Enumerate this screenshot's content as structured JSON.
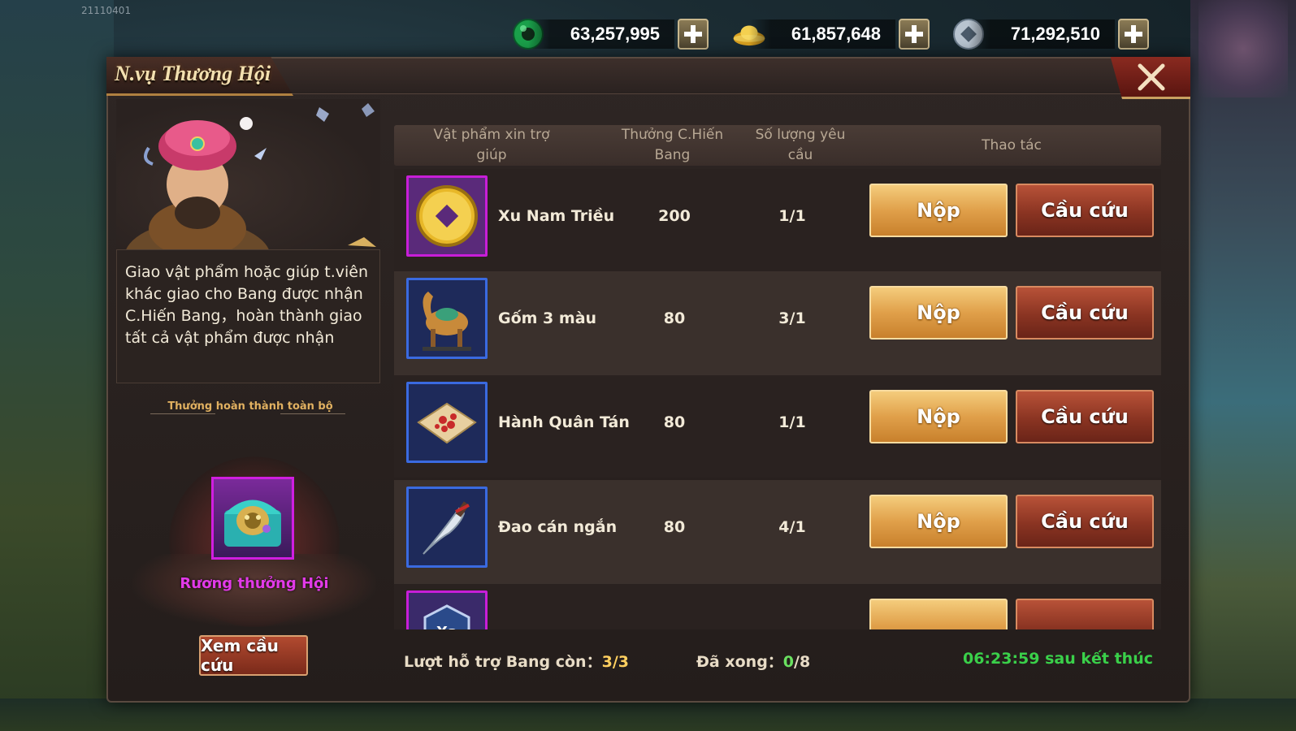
{
  "build_id": "21110401",
  "currencies": [
    {
      "name": "jade",
      "icon": "jade-ring-icon",
      "value": "63,257,995"
    },
    {
      "name": "gold",
      "icon": "gold-ingot-icon",
      "value": "61,857,648"
    },
    {
      "name": "silver",
      "icon": "silver-coin-icon",
      "value": "71,292,510"
    }
  ],
  "panel": {
    "title": "N.vụ Thương Hội",
    "npc_description": "Giao vật phẩm hoặc giúp t.viên khác giao cho Bang được nhận C.Hiến Bang，hoàn thành giao tất cả vật phẩm được nhận",
    "reward_label": "Thưởng hoàn thành toàn bộ",
    "reward_item_name": "Rương thưởng Hội",
    "view_help_button": "Xem cầu cứu"
  },
  "table": {
    "headers": {
      "item": "Vật phẩm xin trợ giúp",
      "reward": "Thưởng C.Hiến Bang",
      "quantity": "Số lượng yêu cầu",
      "action": "Thao tác"
    },
    "rows": [
      {
        "name": "Xu Nam Triều",
        "icon": "gold-coin-icon",
        "reward": "200",
        "quantity": "1/1",
        "border": "#c81ed8",
        "bg": "#5a2a7a"
      },
      {
        "name": "Gốm 3 màu",
        "icon": "ceramic-camel-icon",
        "reward": "80",
        "quantity": "3/1",
        "border": "#3a6ae0",
        "bg": "#1e2a5a"
      },
      {
        "name": "Hành Quân Tán",
        "icon": "medicine-packet-icon",
        "reward": "80",
        "quantity": "1/1",
        "border": "#3a6ae0",
        "bg": "#1e2a5a"
      },
      {
        "name": "Đao cán ngắn",
        "icon": "short-saber-icon",
        "reward": "80",
        "quantity": "4/1",
        "border": "#3a6ae0",
        "bg": "#1e2a5a"
      },
      {
        "name": "",
        "icon": "xa-badge-icon",
        "icon_text": "Xa",
        "reward": "",
        "quantity": "",
        "border": "#c81ed8",
        "bg": "#3a2a6a"
      }
    ],
    "submit_label": "Nộp",
    "help_label": "Cầu cứu"
  },
  "footer": {
    "support_label": "Lượt hỗ trợ Bang còn：",
    "support_value": "3/3",
    "done_label": "Đã xong：",
    "done_value": "0",
    "done_total": "/8",
    "timer": "06:23:59 sau kết thúc"
  }
}
